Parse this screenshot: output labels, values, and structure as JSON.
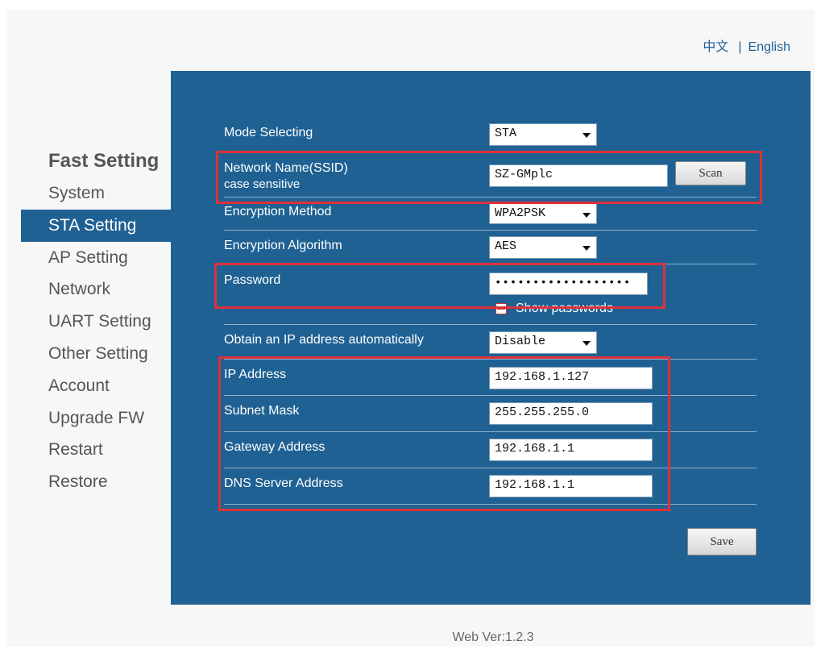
{
  "lang": {
    "zh": "中文",
    "sep": "|",
    "en": "English"
  },
  "sidebar": {
    "heading": "Fast Setting",
    "items": [
      {
        "label": "System"
      },
      {
        "label": "STA Setting",
        "active": true
      },
      {
        "label": "AP Setting"
      },
      {
        "label": "Network"
      },
      {
        "label": "UART Setting"
      },
      {
        "label": "Other Setting"
      },
      {
        "label": "Account"
      },
      {
        "label": "Upgrade FW"
      },
      {
        "label": "Restart"
      },
      {
        "label": "Restore"
      }
    ]
  },
  "form": {
    "mode": {
      "label": "Mode Selecting",
      "value": "STA"
    },
    "ssid": {
      "label_line1": "Network Name(SSID)",
      "label_line2": "case sensitive",
      "value": "SZ-GMplc",
      "scan": "Scan"
    },
    "encryption_method": {
      "label": "Encryption Method",
      "value": "WPA2PSK"
    },
    "encryption_algorithm": {
      "label": "Encryption Algorithm",
      "value": "AES"
    },
    "password": {
      "label": "Password",
      "value": "••••••••••••••••••",
      "show_label": "Show passwords"
    },
    "dhcp": {
      "label": "Obtain an IP address automatically",
      "value": "Disable"
    },
    "ip": {
      "label": "IP Address",
      "value": "192.168.1.127"
    },
    "subnet": {
      "label": "Subnet Mask",
      "value": "255.255.255.0"
    },
    "gateway": {
      "label": "Gateway Address",
      "value": "192.168.1.1"
    },
    "dns": {
      "label": "DNS Server Address",
      "value": "192.168.1.1"
    },
    "save": "Save"
  },
  "footer": {
    "version": "Web Ver:1.2.3"
  }
}
